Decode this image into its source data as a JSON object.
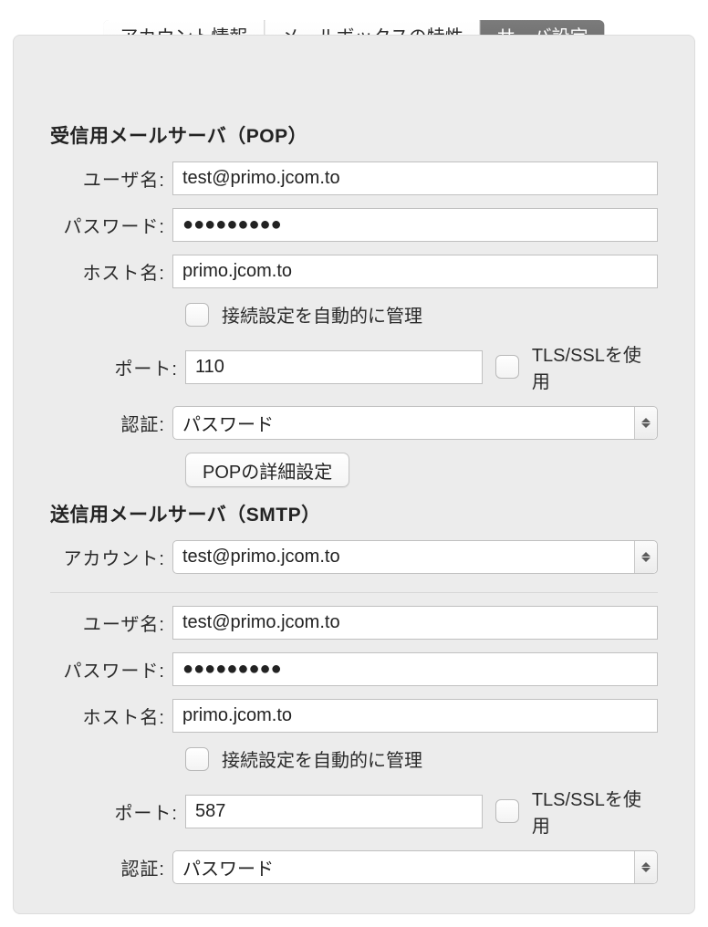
{
  "tabs": {
    "account_info": "アカウント情報",
    "mailbox_behavior": "メールボックスの特性",
    "server_settings": "サーバ設定"
  },
  "labels": {
    "username": "ユーザ名:",
    "password": "パスワード:",
    "hostname": "ホスト名:",
    "port": "ポート:",
    "auth": "認証:",
    "account": "アカウント:",
    "auto_manage": "接続設定を自動的に管理",
    "tls_ssl": "TLS/SSLを使用"
  },
  "incoming": {
    "title": "受信用メールサーバ（POP）",
    "username": "test@primo.jcom.to",
    "password": "●●●●●●●●●",
    "hostname": "primo.jcom.to",
    "auto_manage_checked": false,
    "port": "110",
    "tls_checked": false,
    "auth": "パスワード",
    "advanced_button": "POPの詳細設定"
  },
  "outgoing": {
    "title": "送信用メールサーバ（SMTP）",
    "account": "test@primo.jcom.to",
    "username": "test@primo.jcom.to",
    "password": "●●●●●●●●●",
    "hostname": "primo.jcom.to",
    "auto_manage_checked": false,
    "port": "587",
    "tls_checked": false,
    "auth": "パスワード"
  }
}
